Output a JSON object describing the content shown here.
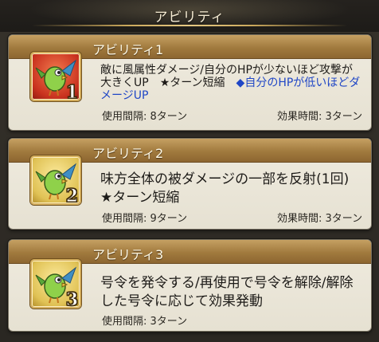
{
  "header": {
    "title": "アビリティ"
  },
  "abilities": [
    {
      "name": "アビリティ1",
      "icon": "green-bird-icon",
      "number": "1",
      "description_main": "敵に風属性ダメージ/自分のHPが少ないほど攻撃が大きくUP　★ターン短縮　",
      "description_extra": "◆自分のHPが低いほどダメージUP",
      "cooldown": "使用間隔: 8ターン",
      "duration": "効果時間: 3ターン"
    },
    {
      "name": "アビリティ2",
      "icon": "green-bird-icon",
      "number": "2",
      "description_main": "味方全体の被ダメージの一部を反射(1回)　★ターン短縮",
      "cooldown": "使用間隔: 9ターン",
      "duration": "効果時間: 3ターン"
    },
    {
      "name": "アビリティ3",
      "icon": "green-bird-icon",
      "number": "3",
      "description_main": "号令を発令する/再使用で号令を解除/解除した号令に応じて効果発動",
      "cooldown": "使用間隔: 3ターン"
    }
  ],
  "colors": {
    "icon1_bg": "#d9402a",
    "icon2_bg": "#e0c255",
    "icon3_bg": "#e0c255",
    "extra_text": "#1f46c6"
  }
}
